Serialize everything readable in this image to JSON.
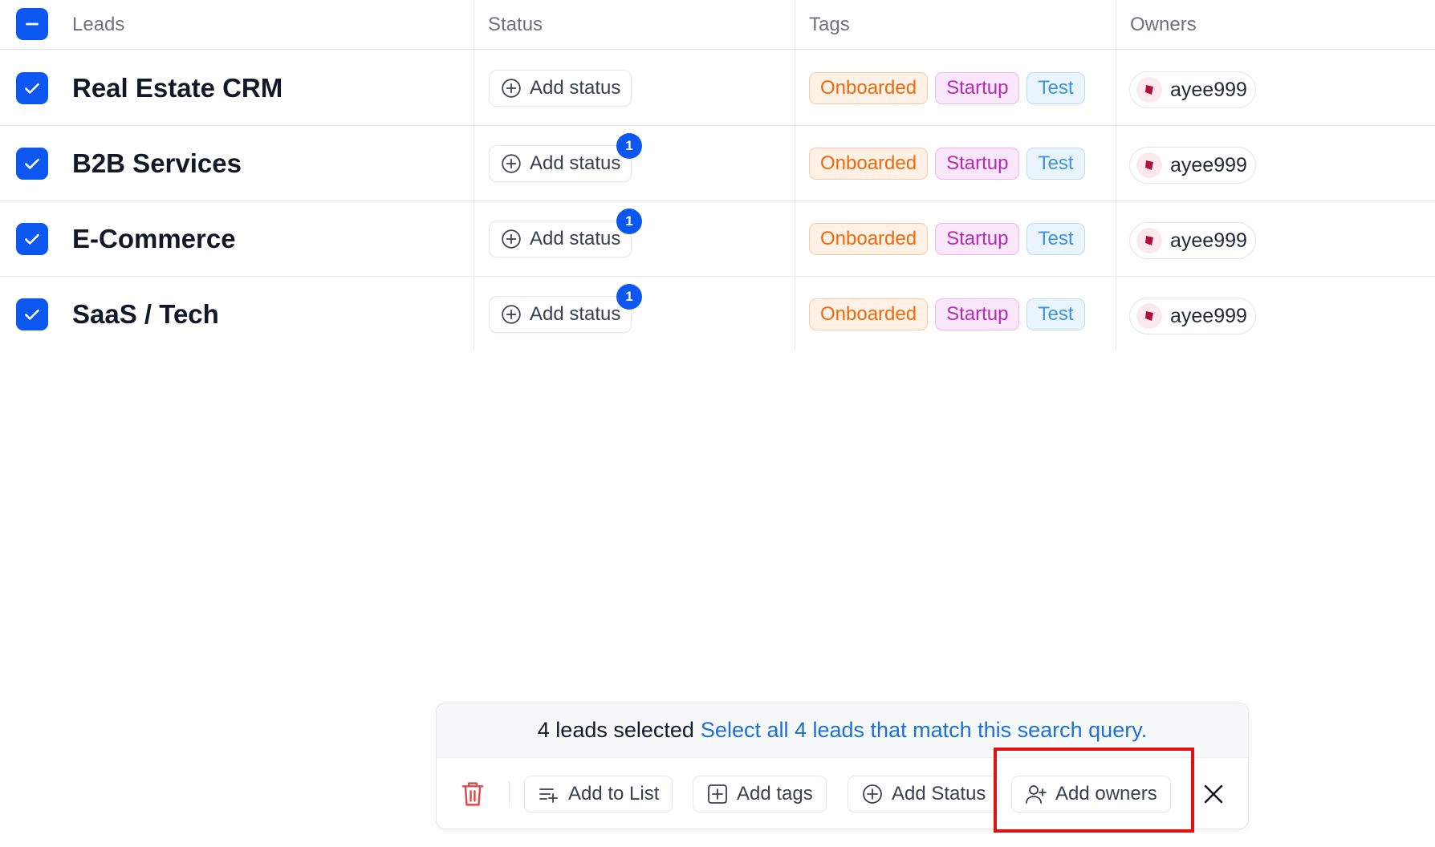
{
  "table": {
    "headers": {
      "leads": "Leads",
      "status": "Status",
      "tags": "Tags",
      "owners": "Owners"
    },
    "rows": [
      {
        "name": "Real Estate CRM",
        "status_label": "Add status",
        "badge": "",
        "tags": [
          "Onboarded",
          "Startup",
          "Test"
        ],
        "owner": "ayee999"
      },
      {
        "name": "B2B Services",
        "status_label": "Add status",
        "badge": "1",
        "tags": [
          "Onboarded",
          "Startup",
          "Test"
        ],
        "owner": "ayee999"
      },
      {
        "name": "E-Commerce",
        "status_label": "Add status",
        "badge": "1",
        "tags": [
          "Onboarded",
          "Startup",
          "Test"
        ],
        "owner": "ayee999"
      },
      {
        "name": "SaaS / Tech",
        "status_label": "Add status",
        "badge": "1",
        "tags": [
          "Onboarded",
          "Startup",
          "Test"
        ],
        "owner": "ayee999"
      }
    ]
  },
  "bulk_bar": {
    "selected_text": "4 leads selected",
    "select_all_link": "Select all 4 leads that match this search query.",
    "actions": {
      "add_to_list": "Add to List",
      "add_tags": "Add tags",
      "add_status": "Add Status",
      "add_owners": "Add owners"
    }
  },
  "colors": {
    "accent": "#0b57f0",
    "tag_onboarded": "#ea6a0c",
    "tag_startup": "#b829b8",
    "tag_test": "#3b93e2",
    "highlight": "#e01111",
    "delete": "#e04848"
  },
  "icons": {
    "header_checkbox": "minus-checkbox-icon",
    "row_checkbox": "check-icon",
    "status": "plus-circle-icon",
    "delete": "trash-icon",
    "add_to_list": "list-add-icon",
    "add_tags": "plus-square-icon",
    "add_status": "plus-circle-icon",
    "add_owners": "user-plus-icon",
    "close": "close-icon"
  }
}
